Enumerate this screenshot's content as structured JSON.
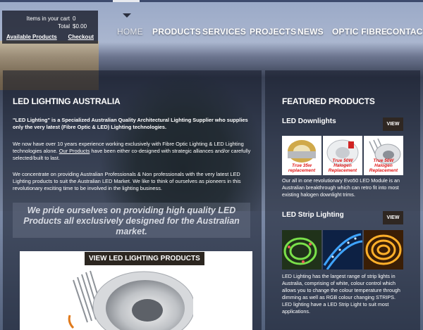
{
  "cart": {
    "items_label": "Items in your cart",
    "items_count": "0",
    "total_label": "Total",
    "total_value": "$0.00",
    "available_products": "Available Products",
    "checkout": "Checkout"
  },
  "nav": {
    "items": [
      "HOME",
      "PRODUCTS",
      "SERVICES",
      "PROJECTS",
      "NEWS",
      "OPTIC FIBRE",
      "CONTACT"
    ]
  },
  "left": {
    "title": "LED LIGHTING AUSTRALIA",
    "p1": "\"LED Lighting\" is a Specialized Australian Quality Architectural Lighting Supplier who supplies only the very latest (Fibre Optic & LED) Lighting technologies.",
    "p2_a": "We now have over 10 years experience working exclusively with Fibre Optic Lighting & LED Lighting technologies alone. ",
    "p2_link": "Our Products",
    "p2_b": " have been either co-designed with strategic alliances and/or carefully selected/built to last.",
    "p3": "We concentrate on providing Australian Professionals & Non professionals with the very latest LED Lighting products to suit the Australian LED Market. We like to think of ourselves as pioneers in this revolutionary exciting time to be involved in the lighting business.",
    "quote": "We pride ourselves on providing high quality LED Products all exclusively designed for the Australian market.",
    "view_products_button": "VIEW LED LIGHTING PRODUCTS"
  },
  "right": {
    "title": "FEATURED PRODUCTS",
    "downlights": {
      "title": "LED Downlights",
      "view": "VIEW",
      "captions": [
        "True 35w replacement",
        "True 50W Halogen Replacement",
        "True 50W Halogen Replacement"
      ],
      "text": "Our all in one revolutionary Evo50 LED Module is an Australian breakthrough which can retro fit into most existing halogen downlight trims."
    },
    "strips": {
      "title": "LED Strip Lighting",
      "view": "VIEW",
      "text": "LED Lighting has the largest range of strip lights in Australia, comprising of white, colour control which allows you to change the colour temperature through dimming as well as RGB colour changing STRIPS. LED lighting have a LED Strip Light to suit most applications."
    }
  },
  "colors": {
    "panel": "#141a28",
    "button": "#2c2620",
    "caption_red": "#e01919"
  }
}
